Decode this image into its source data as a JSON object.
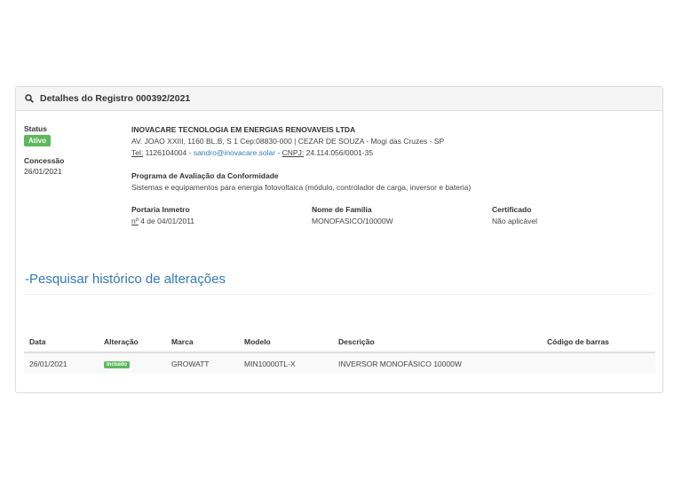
{
  "panel": {
    "title": "Detalhes do Registro 000392/2021",
    "status_label": "Status",
    "status_value": "Ativo",
    "concessao_label": "Concessão",
    "concessao_value": "26/01/2021",
    "company": "INOVACARE TECNOLOGIA EM ENERGIAS RENOVAVEIS LTDA",
    "address": "AV. JOAO XXIII, 1160 BL.B, S 1 Cep:08830-000 | CEZAR DE SOUZA - Mogi das Cruzes - SP",
    "tel_label": "Tel:",
    "tel_value": "1126104004",
    "email": "sandro@inovacare.solar",
    "cnpj_label": "CNPJ:",
    "cnpj_value": "24.114.056/0001-35",
    "program_label": "Programa de Avaliação da Conformidade",
    "program_value": "Sistemas e equipamentos para energia fotovoltaica (módulo, controlador de carga, inversor e bateria)",
    "portaria_label": "Portaria Inmetro",
    "portaria_prefix": "nº",
    "portaria_value": "4 de 04/01/2011",
    "familia_label": "Nome de Família",
    "familia_value": "MONOFASICO/10000W",
    "certificado_label": "Certificado",
    "certificado_value": "Não aplicável"
  },
  "history": {
    "title": "-Pesquisar histórico de alterações",
    "columns": [
      "Data",
      "Alteração",
      "Marca",
      "Modelo",
      "Descrição",
      "Código de barras"
    ],
    "rows": [
      {
        "data": "26/01/2021",
        "alteracao": "Incluído",
        "marca": "GROWATT",
        "modelo": "MIN10000TL-X",
        "descricao": "INVERSOR MONOFÁSICO 10000W",
        "codigo": ""
      }
    ]
  },
  "colors": {
    "accent": "#337ab7",
    "success": "#5cb85c"
  },
  "icons": {
    "header": "search-icon"
  }
}
